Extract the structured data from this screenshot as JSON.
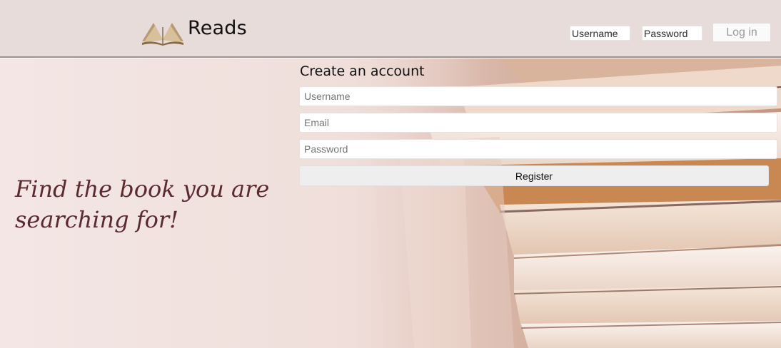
{
  "header": {
    "logo_icon": "open-book-icon",
    "brand": "Reads",
    "username_placeholder": "Username",
    "password_placeholder": "Password",
    "login_label": "Log in"
  },
  "hero": {
    "tagline": "Find the book you are searching for!"
  },
  "register_form": {
    "title": "Create an account",
    "username_placeholder": "Username",
    "email_placeholder": "Email",
    "password_placeholder": "Password",
    "submit_label": "Register"
  },
  "colors": {
    "header_bg": "#e8dcdb",
    "tagline": "#5a2a2e"
  }
}
